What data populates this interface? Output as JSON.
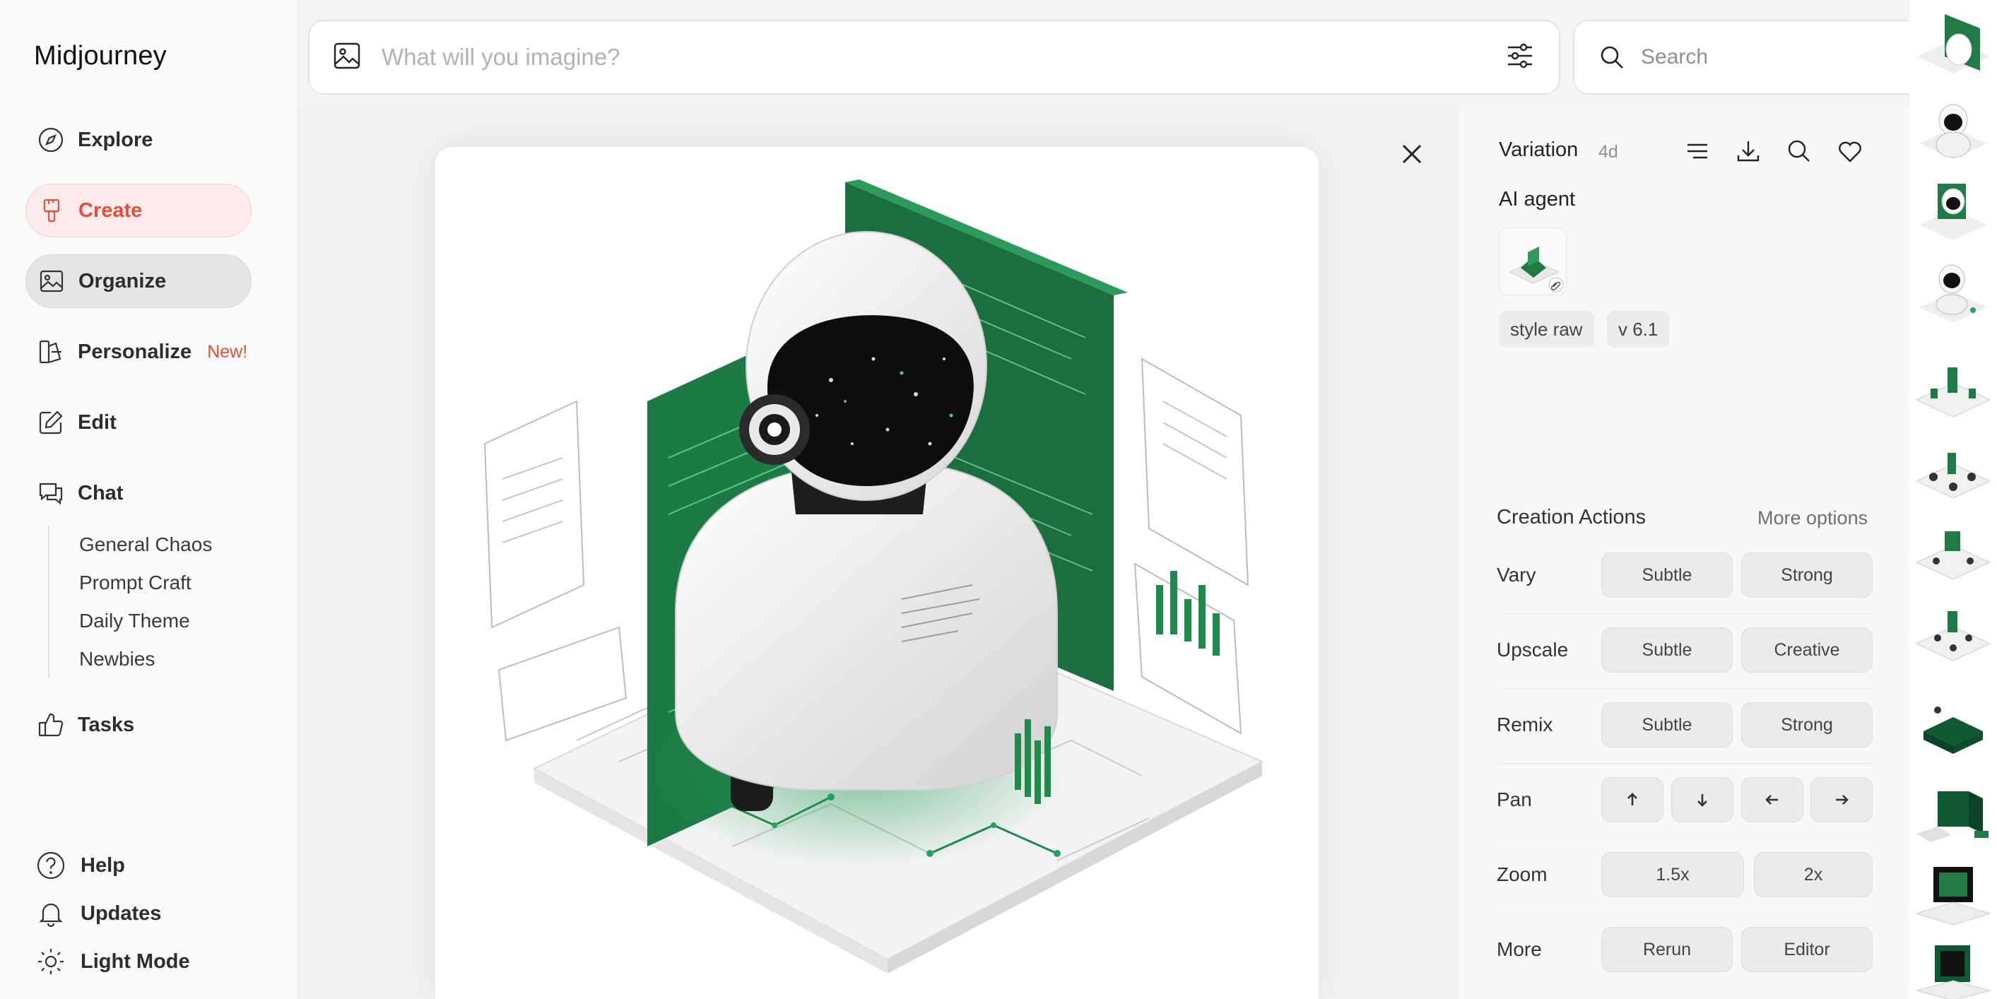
{
  "sidebar": {
    "logo": "Midjourney",
    "nav": [
      {
        "label": "Explore"
      },
      {
        "label": "Create"
      },
      {
        "label": "Organize"
      },
      {
        "label": "Personalize",
        "badge": "New!"
      },
      {
        "label": "Edit"
      },
      {
        "label": "Chat"
      }
    ],
    "chat_channels": [
      "General Chaos",
      "Prompt Craft",
      "Daily Theme",
      "Newbies"
    ],
    "tasks_label": "Tasks",
    "bottom": [
      {
        "label": "Help",
        "icon": "help-circle-icon"
      },
      {
        "label": "Updates",
        "icon": "bell-icon"
      },
      {
        "label": "Light Mode",
        "icon": "sun-icon"
      }
    ]
  },
  "topbar": {
    "imagine_placeholder": "What will you imagine?",
    "search_placeholder": "Search"
  },
  "panel": {
    "title": "Variation",
    "time": "4d",
    "prompt": "AI agent",
    "tags": [
      "style raw",
      "v 6.1"
    ],
    "creation_actions_title": "Creation Actions",
    "more_options": "More options",
    "rows": [
      {
        "label": "Vary",
        "buttons": [
          "Subtle",
          "Strong"
        ]
      },
      {
        "label": "Upscale",
        "buttons": [
          "Subtle",
          "Creative"
        ]
      },
      {
        "label": "Remix",
        "buttons": [
          "Subtle",
          "Strong"
        ]
      },
      {
        "label": "Pan",
        "buttons": [
          "arrow-up-icon",
          "arrow-down-icon",
          "arrow-left-icon",
          "arrow-right-icon"
        ]
      },
      {
        "label": "Zoom",
        "buttons": [
          "1.5x",
          "2x"
        ]
      },
      {
        "label": "More",
        "buttons": [
          "Rerun",
          "Editor"
        ]
      }
    ]
  },
  "colors": {
    "accent": "#e24f3f",
    "green": "#1f7a45",
    "dark_green": "#0f5a31"
  }
}
